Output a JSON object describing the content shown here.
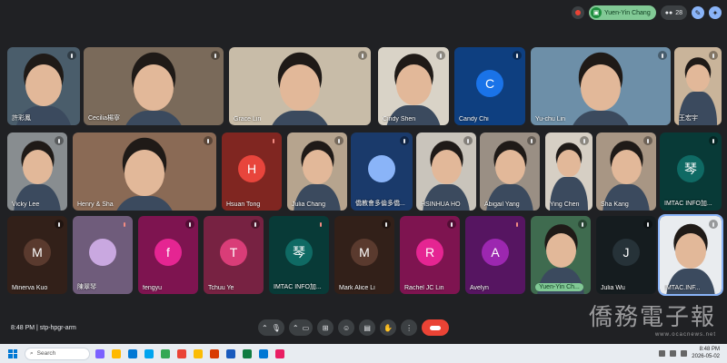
{
  "topbar": {
    "presenter_name": "Yuen-Yin Chang",
    "participant_count": "28"
  },
  "tiles": [
    {
      "name": "許彩鳳",
      "kind": "video"
    },
    {
      "name": "Cecilia楊寧",
      "kind": "video"
    },
    {
      "name": "Grace Lin",
      "kind": "video"
    },
    {
      "name": "Cindy Shen",
      "kind": "video"
    },
    {
      "name": "Candy Chi",
      "kind": "avatar",
      "initial": "C",
      "color": "#1a73e8"
    },
    {
      "name": "Yu-chu Lin",
      "kind": "video"
    },
    {
      "name": "王宏宇",
      "kind": "video"
    },
    {
      "name": "Vicky Lee",
      "kind": "video"
    },
    {
      "name": "Henry & Sha",
      "kind": "video"
    },
    {
      "name": "Hsuan Tong",
      "kind": "avatar",
      "initial": "H",
      "color": "#e8453c"
    },
    {
      "name": "Julia Chang",
      "kind": "video"
    },
    {
      "name": "僑教會多倫多僑...",
      "kind": "avatar",
      "initial": "",
      "color": "#8ab4f8"
    },
    {
      "name": "HSINHUA HO",
      "kind": "video"
    },
    {
      "name": "Abigail Yang",
      "kind": "video"
    },
    {
      "name": "Ying Chen",
      "kind": "video"
    },
    {
      "name": "Sha Kang",
      "kind": "video"
    },
    {
      "name": "IMTAC INFO加...",
      "kind": "avatar",
      "initial": "琴",
      "color": "#0f6a64"
    },
    {
      "name": "Minerva Kuo",
      "kind": "avatar",
      "initial": "M",
      "color": "#5a3a2e"
    },
    {
      "name": "陳翠琴",
      "kind": "avatar",
      "initial": "",
      "color": "#c9a8e0"
    },
    {
      "name": "fengyu",
      "kind": "avatar",
      "initial": "f",
      "color": "#e52592"
    },
    {
      "name": "Tchuu Ye",
      "kind": "avatar",
      "initial": "T",
      "color": "#d93d78"
    },
    {
      "name": "IMTAC INFO加...",
      "kind": "avatar",
      "initial": "琴",
      "color": "#0f6a64"
    },
    {
      "name": "Mark Alice Li",
      "kind": "avatar",
      "initial": "M",
      "color": "#5a3a2e"
    },
    {
      "name": "Rachel JC Lin",
      "kind": "avatar",
      "initial": "R",
      "color": "#e52592"
    },
    {
      "name": "Avelyn",
      "kind": "avatar",
      "initial": "A",
      "color": "#9c27b0"
    },
    {
      "name": "Yuen-Yin Ch...",
      "kind": "video"
    },
    {
      "name": "Julia Wu",
      "kind": "avatar",
      "initial": "J",
      "color": "#263238"
    },
    {
      "name": "IMTAC.INF...",
      "kind": "video"
    }
  ],
  "bottombar": {
    "time": "8:48 PM",
    "meeting_code": "stp-hpgr-arm"
  },
  "watermark": {
    "text": "僑務電子報",
    "url": "www.ocacnews.net"
  },
  "taskbar": {
    "search_placeholder": "Search",
    "time": "8:48 PM",
    "date": "2026-05-02"
  },
  "colors": {
    "background": "#202124",
    "end_call": "#ea4335",
    "presenter": "#81c995",
    "accent": "#8ab4f8"
  }
}
